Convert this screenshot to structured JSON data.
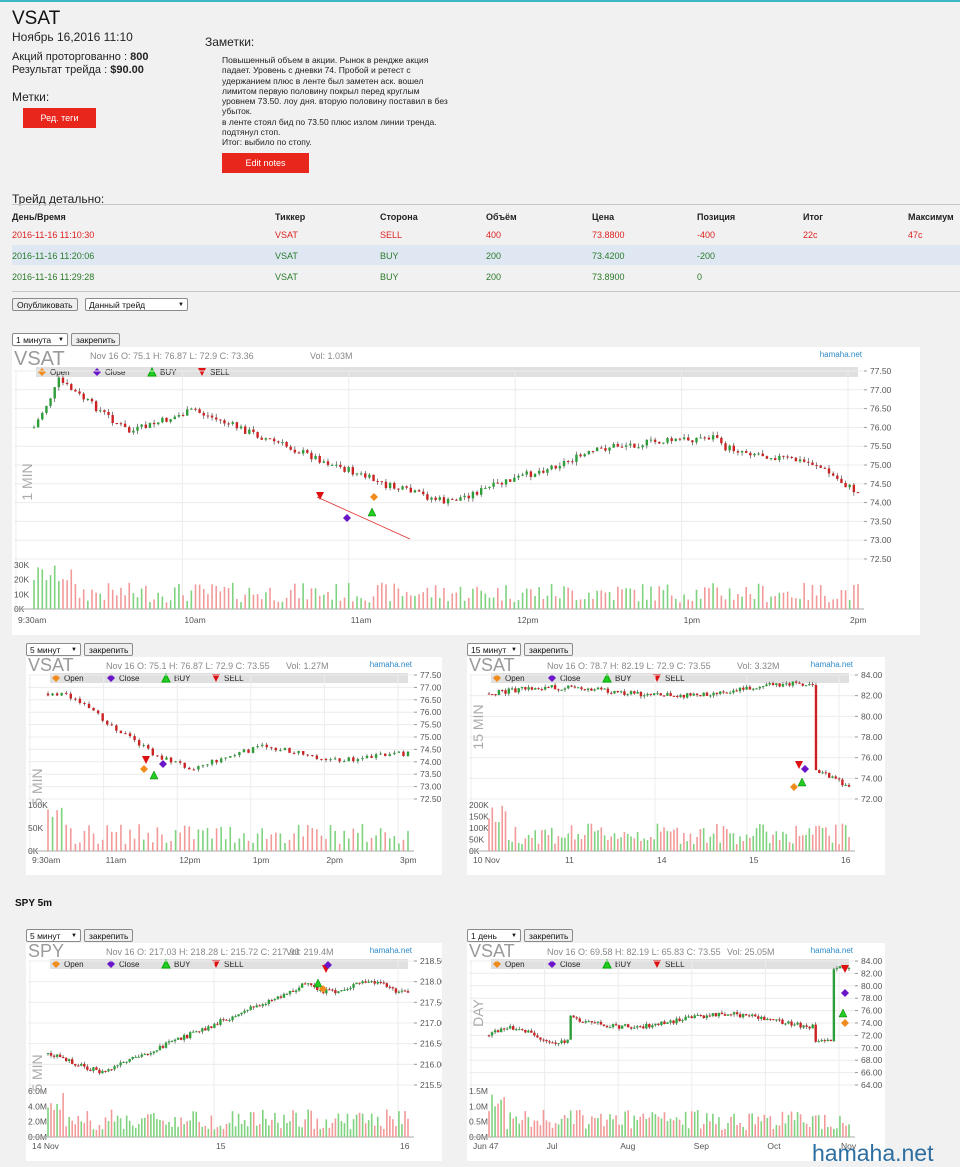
{
  "header": {
    "ticker": "VSAT",
    "date": "Ноябрь 16,2016 11:10",
    "shares_label": "Акций проторгованно :",
    "shares_value": "800",
    "result_label": "Результат трейда :",
    "result_value": "$90.00",
    "tags_label": "Метки:",
    "tags_button": "Ред. теги"
  },
  "notes": {
    "label": "Заметки:",
    "text": "Повышенный объем в акции. Рынок в рендже акция\nпадает. Уровень с дневки 74. Пробой и ретест с\nудержанием плюс в ленте был заметен аск. вошел\nлимитом первую половину покрыл перед круглым\nуровнем 73.50. лоу дня. вторую половину поставил в без\nубыток.\nв ленте стоял бид по 73.50 плюс излом линии тренда.\nподтянул стоп.\nИтог: выбило по стопу.",
    "edit_button": "Edit notes"
  },
  "details": {
    "label": "Трейд детально:",
    "columns": [
      "День/Время",
      "Тиккер",
      "Сторона",
      "Объём",
      "Цена",
      "Позиция",
      "Итог",
      "Максимум"
    ],
    "rows": [
      [
        "2016-11-16 11:10:30",
        "VSAT",
        "SELL",
        "400",
        "73.8800",
        "-400",
        "22c",
        "47c"
      ],
      [
        "2016-11-16 11:20:06",
        "VSAT",
        "BUY",
        "200",
        "73.4200",
        "-200",
        "",
        ""
      ],
      [
        "2016-11-16 11:29:28",
        "VSAT",
        "BUY",
        "200",
        "73.8900",
        "0",
        "",
        ""
      ]
    ]
  },
  "publish": {
    "button": "Опубликовать",
    "scope": "Данный трейд"
  },
  "pin_label": "закрепить",
  "spy_label": "SPY 5m",
  "watermark": "hamaha.net",
  "colors": {
    "up": "#2e9e3a",
    "down": "#cc2222",
    "vol_up": "#7fd27f",
    "vol_down": "#f29a9a",
    "open_marker": "#f08c1e",
    "close_marker": "#6a16c8",
    "buy_marker": "#22cc22",
    "sell_marker": "#dd1111",
    "sell_button": "#e8261c",
    "link": "#2d8ac7"
  },
  "charts": [
    {
      "interval": "1 минута",
      "symbol": "VSAT",
      "info": "Nov 16 O: 75.1 H: 76.87 L: 72.9 C: 73.36",
      "vol": "Vol: 1.03M",
      "side_label": "1 MIN",
      "brand": "hamaha.net",
      "legend": [
        "Open",
        "Close",
        "BUY",
        "SELL"
      ],
      "price_ticks": [
        "77.50",
        "77.00",
        "76.50",
        "76.00",
        "75.50",
        "75.00",
        "74.50",
        "74.00",
        "73.50",
        "73.00",
        "72.50"
      ],
      "vol_ticks": [
        "30K",
        "20K",
        "10K",
        "0K"
      ],
      "x_ticks": [
        "9:30am",
        "10am",
        "11am",
        "12pm",
        "1pm",
        "2pm"
      ]
    },
    {
      "interval": "5 минут",
      "symbol": "VSAT",
      "info": "Nov 16 O: 75.1 H: 76.87 L: 72.9 C: 73.55",
      "vol": "Vol: 1.27M",
      "side_label": "5 MIN",
      "brand": "hamaha.net",
      "legend": [
        "Open",
        "Close",
        "BUY",
        "SELL"
      ],
      "price_ticks": [
        "77.50",
        "77.00",
        "76.50",
        "76.00",
        "75.50",
        "75.00",
        "74.50",
        "74.00",
        "73.50",
        "73.00",
        "72.50"
      ],
      "vol_ticks": [
        "100K",
        "50K",
        "0K"
      ],
      "x_ticks": [
        "9:30am",
        "11am",
        "12pm",
        "1pm",
        "2pm",
        "3pm"
      ]
    },
    {
      "interval": "15 минут",
      "symbol": "VSAT",
      "info": "Nov 16 O: 78.7 H: 82.19 L: 72.9 C: 73.55",
      "vol": "Vol: 3.32M",
      "side_label": "15 MIN",
      "brand": "hamaha.net",
      "legend": [
        "Open",
        "Close",
        "BUY",
        "SELL"
      ],
      "price_ticks": [
        "84.00",
        "82.00",
        "80.00",
        "78.00",
        "76.00",
        "74.00",
        "72.00"
      ],
      "vol_ticks": [
        "200K",
        "150K",
        "100K",
        "50K",
        "0K"
      ],
      "x_ticks": [
        "10 Nov",
        "11",
        "14",
        "15",
        "16"
      ]
    },
    {
      "interval": "5 минут",
      "symbol": "SPY",
      "info": "Nov 16 O: 217.03 H: 218.28 L: 215.72 C: 217.93",
      "vol": "Vol: 219.4M",
      "side_label": "5 MIN",
      "brand": "hamaha.net",
      "legend": [
        "Open",
        "Close",
        "BUY",
        "SELL"
      ],
      "price_ticks": [
        "218.50",
        "218.00",
        "217.50",
        "217.00",
        "216.50",
        "216.00",
        "215.50"
      ],
      "vol_ticks": [
        "6.0M",
        "4.0M",
        "2.0M",
        "0.0M"
      ],
      "x_ticks": [
        "14 Nov",
        "15",
        "16"
      ]
    },
    {
      "interval": "1 день",
      "symbol": "VSAT",
      "info": "Nov 16 O: 69.58 H: 82.19 L: 65.83 C: 73.55",
      "vol": "Vol: 25.05M",
      "side_label": "DAY",
      "brand": "hamaha.net",
      "legend": [
        "Open",
        "Close",
        "BUY",
        "SELL"
      ],
      "price_ticks": [
        "84.00",
        "82.00",
        "80.00",
        "78.00",
        "76.00",
        "74.00",
        "72.00",
        "70.00",
        "68.00",
        "66.00",
        "64.00"
      ],
      "vol_ticks": [
        "1.5M",
        "1.0M",
        "0.5M",
        "0.0M"
      ],
      "x_ticks": [
        "Jun 47",
        "Jul",
        "Aug",
        "Sep",
        "Oct",
        "Nov"
      ]
    }
  ]
}
